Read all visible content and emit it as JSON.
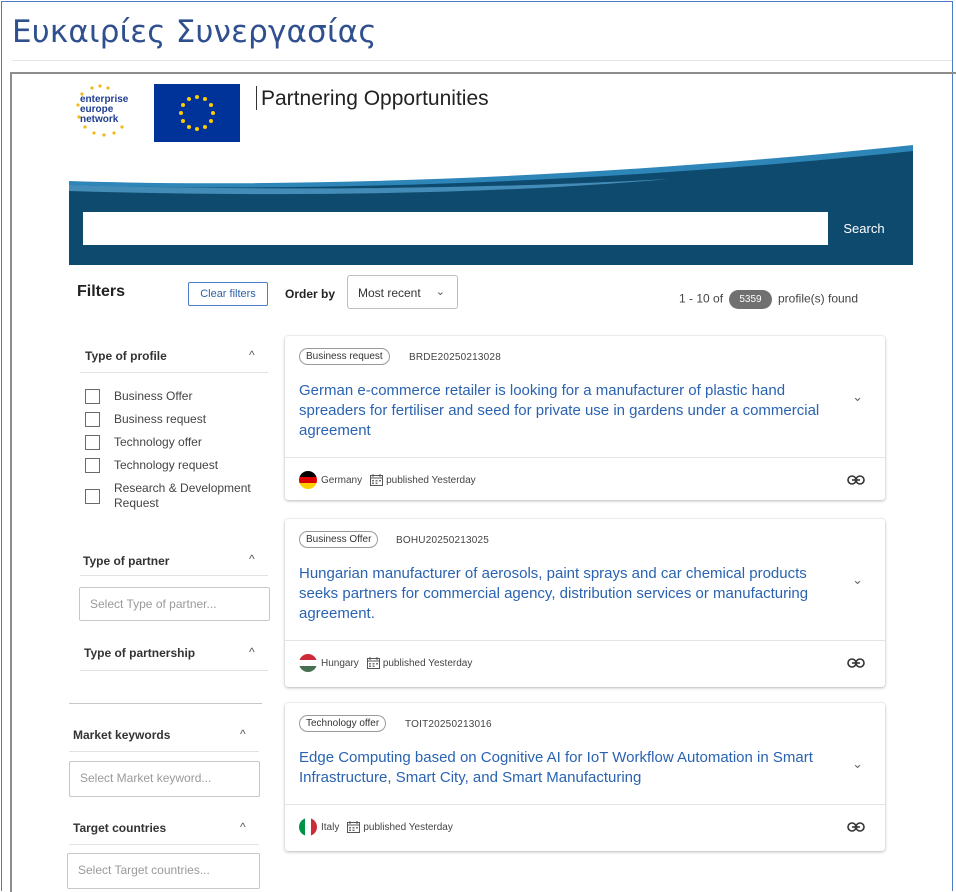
{
  "page": {
    "heading": "Ευκαιρίες Συνεργασίας"
  },
  "site": {
    "logo_line1": "enterprise",
    "logo_line2": "europe",
    "logo_line3": "network",
    "title": "Partnering Opportunities"
  },
  "search": {
    "placeholder": "",
    "button_label": "Search"
  },
  "filters": {
    "title": "Filters",
    "clear_label": "Clear filters",
    "type_of_profile": {
      "label": "Type of profile",
      "options": [
        "Business Offer",
        "Business request",
        "Technology offer",
        "Technology request",
        "Research & Development Request"
      ]
    },
    "type_of_partner": {
      "label": "Type of partner",
      "placeholder": "Select Type of partner..."
    },
    "type_of_partnership": {
      "label": "Type of partnership"
    },
    "market_keywords": {
      "label": "Market keywords",
      "placeholder": "Select Market keyword..."
    },
    "target_countries": {
      "label": "Target countries",
      "placeholder": "Select Target countries..."
    }
  },
  "order": {
    "label": "Order by",
    "selected": "Most recent",
    "chevron": "⌄"
  },
  "results": {
    "range": "1 - 10 of",
    "total": "5359",
    "suffix": "profile(s) found"
  },
  "cards": [
    {
      "type": "Business request",
      "ref": "BRDE20250213028",
      "title": "German e-commerce retailer is looking for a manufacturer of plastic hand spreaders for fertiliser and seed for private use in gardens under a commercial agreement",
      "country": "Germany",
      "published": "published Yesterday"
    },
    {
      "type": "Business Offer",
      "ref": "BOHU20250213025",
      "title": "Hungarian manufacturer of aerosols, paint sprays and car chemical products seeks partners for commercial agency, distribution services or manufacturing agreement.",
      "country": "Hungary",
      "published": "published Yesterday"
    },
    {
      "type": "Technology offer",
      "ref": "TOIT20250213016",
      "title": "Edge Computing based on Cognitive AI for IoT Workflow Automation in Smart Infrastructure, Smart City, and Smart Manufacturing",
      "country": "Italy",
      "published": "published Yesterday"
    }
  ],
  "icons": {
    "caret_up": "^",
    "expand": "⌄"
  },
  "colors": {
    "brand_blue": "#0e4a6e",
    "link_blue": "#2a63b2",
    "eu_blue": "#003399",
    "eu_gold": "#ffcc00"
  }
}
